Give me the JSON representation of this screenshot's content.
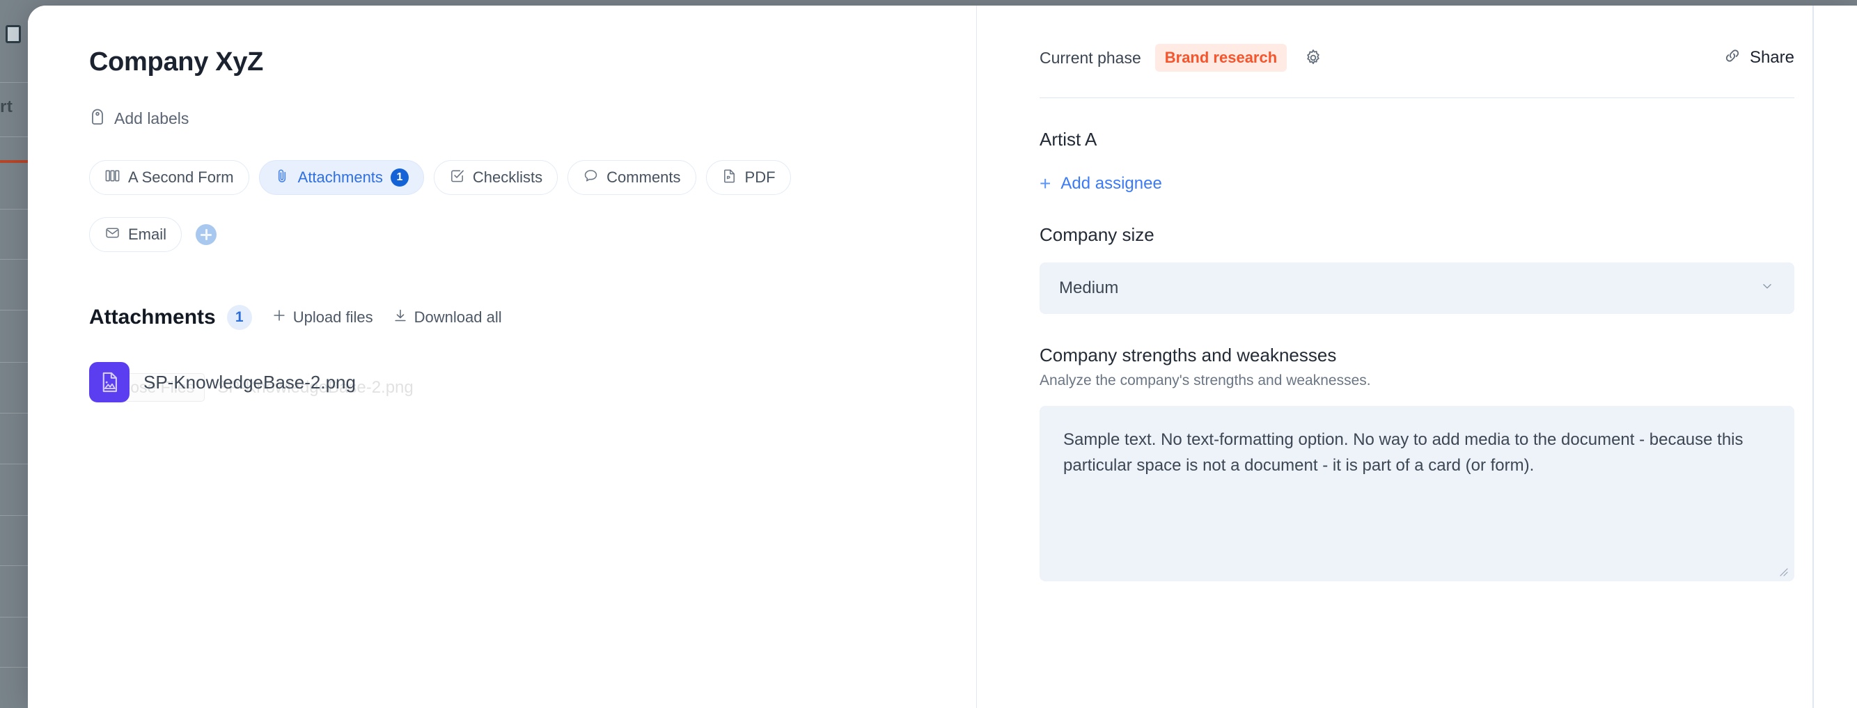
{
  "backdrop": {
    "partial_text": "rt"
  },
  "left_panel": {
    "title": "Company XyZ",
    "add_labels": "Add labels",
    "tabs": [
      {
        "label": "A Second Form",
        "icon": "form-columns-icon",
        "badge": null,
        "active": false
      },
      {
        "label": "Attachments",
        "icon": "paperclip-icon",
        "badge": "1",
        "active": true
      },
      {
        "label": "Checklists",
        "icon": "checklist-icon",
        "badge": null,
        "active": false
      },
      {
        "label": "Comments",
        "icon": "comment-bubble-icon",
        "badge": null,
        "active": false
      },
      {
        "label": "PDF",
        "icon": "pdf-file-icon",
        "badge": null,
        "active": false
      },
      {
        "label": "Email",
        "icon": "envelope-icon",
        "badge": null,
        "active": false
      }
    ],
    "add_tab_icon": "plus-circle-icon",
    "attachments_section": {
      "heading": "Attachments",
      "count": "1",
      "upload_label": "Upload files",
      "download_label": "Download all",
      "native_input": {
        "button_label": "Choose Files",
        "file_label": "SP-KnowledgeBase-2.png"
      },
      "files": [
        {
          "name": "SP-KnowledgeBase-2.png",
          "icon": "image-file-icon"
        }
      ]
    }
  },
  "right_panel": {
    "phase_label": "Current phase",
    "phase_value": "Brand research",
    "phase_chip_color": "#f4552c",
    "phase_chip_bg": "#ffeae4",
    "gear_icon": "gear-icon",
    "share_label": "Share",
    "share_icon": "link-icon",
    "assignee": {
      "label": "Artist A",
      "add_label": "Add assignee"
    },
    "company_size": {
      "label": "Company size",
      "value": "Medium",
      "chevron": "chevron-down-icon"
    },
    "strengths": {
      "label": "Company strengths and weaknesses",
      "help": "Analyze the company's strengths and weaknesses.",
      "value": "Sample text. No text-formatting option. No way to add media to the document - because this particular space is not a document - it is part of a card (or form)."
    }
  }
}
